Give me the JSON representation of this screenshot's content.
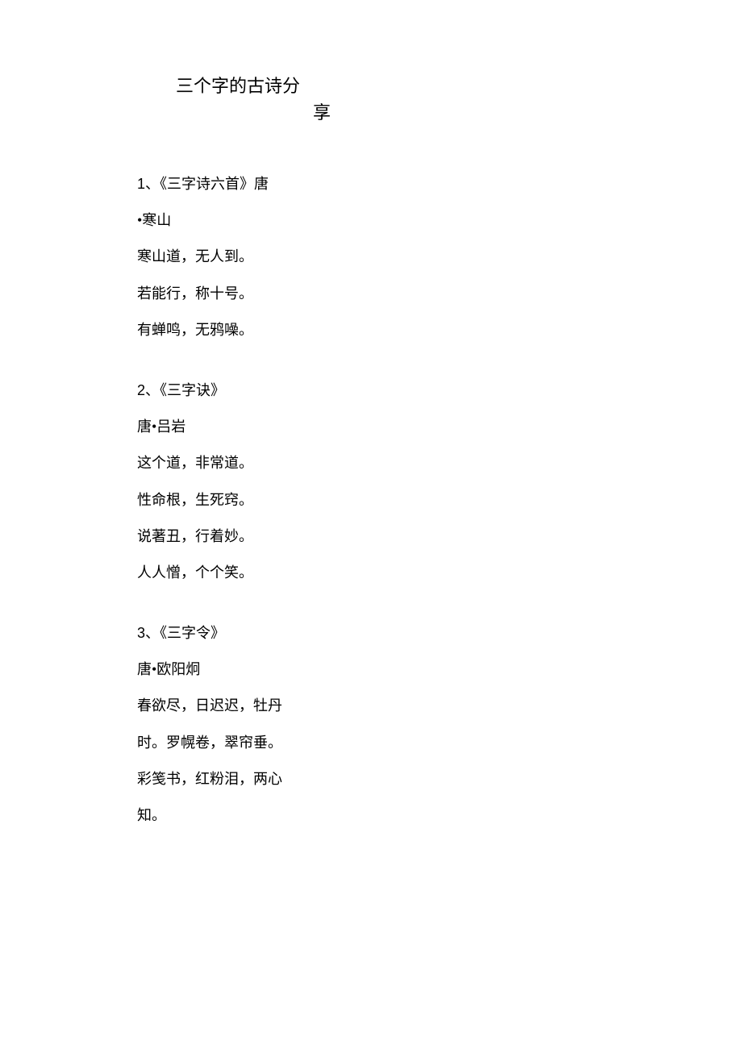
{
  "title": {
    "line1": "三个字的古诗分",
    "line2": "享"
  },
  "poems": [
    {
      "number": "1",
      "separator": "、",
      "title": "《三字诗六首》唐",
      "author": "•寒山",
      "lines": [
        "寒山道，无人到。",
        "若能行，称十号。",
        "有蝉鸣，无鸦噪。"
      ]
    },
    {
      "number": "2",
      "separator": "、",
      "title": "《三字诀》",
      "author": "唐•吕岩",
      "lines": [
        "这个道，非常道。",
        "性命根，生死窍。",
        "说著丑，行着妙。",
        "人人憎，个个笑。"
      ]
    },
    {
      "number": "3",
      "separator": "、",
      "title": "《三字令》",
      "author": "唐•欧阳炯",
      "lines": [
        "春欲尽，日迟迟，牡丹",
        "时。罗幌卷，翠帘垂。",
        "彩笺书，红粉泪，两心",
        "知。"
      ]
    }
  ]
}
